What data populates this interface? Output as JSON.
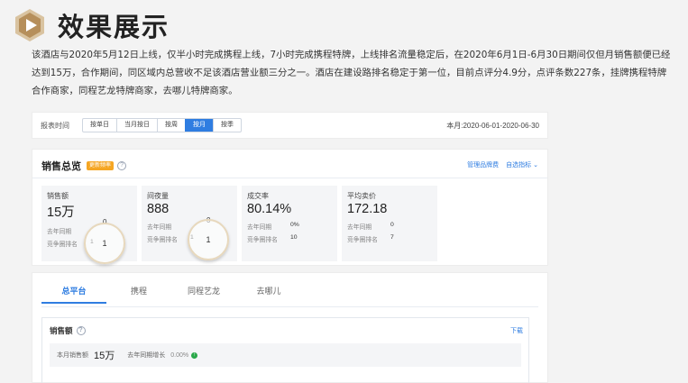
{
  "header": {
    "title": "效果展示",
    "logo_icon": "play-badge-icon"
  },
  "intro": {
    "text": "该酒店与2020年5月12日上线，仅半小时完成携程上线，7小时完成携程特牌，上线排名流量稳定后，在2020年6月1日-6月30日期间仅但月销售额便已经达到15万，合作期间，同区域内总营收不足该酒店营业额三分之一。酒店在建设路排名稳定于第一位，目前点评分4.9分，点评条数227条，挂牌携程特牌合作商家，同程艺龙特牌商家，去哪儿特牌商家。"
  },
  "filter": {
    "label": "报表时间",
    "buttons": [
      "按单日",
      "当月按日",
      "按周",
      "按月",
      "按季"
    ],
    "active_index": 3,
    "date_range": "本月:2020-06-01-2020-06-30"
  },
  "overview": {
    "title": "销售总览",
    "tag": "更新频率",
    "links": [
      "管理品牌费",
      "自选指标"
    ],
    "metrics": [
      {
        "name": "销售额",
        "value": "15万",
        "rows": [
          {
            "label": "去年同期",
            "value": ""
          },
          {
            "label": "竞争圈排名",
            "value": "1"
          }
        ],
        "loupe_top": "0",
        "loupe_value": "1"
      },
      {
        "name": "间夜量",
        "value": "888",
        "rows": [
          {
            "label": "去年同期",
            "value": ""
          },
          {
            "label": "竞争圈排名",
            "value": "1"
          }
        ],
        "loupe_top": "0",
        "loupe_value": "1"
      },
      {
        "name": "成交率",
        "value": "80.14%",
        "rows": [
          {
            "label": "去年同期",
            "value": "0%"
          },
          {
            "label": "竞争圈排名",
            "value": "10"
          }
        ]
      },
      {
        "name": "平均卖价",
        "value": "172.18",
        "rows": [
          {
            "label": "去年同期",
            "value": "0"
          },
          {
            "label": "竞争圈排名",
            "value": "7"
          }
        ]
      }
    ]
  },
  "platform": {
    "tabs": [
      "总平台",
      "携程",
      "同程艺龙",
      "去哪儿"
    ],
    "active_index": 0,
    "sales": {
      "title": "销售额",
      "download": "下载",
      "label": "本月销售额",
      "value": "15万",
      "compare_label": "去年同期增长",
      "compare_value": "0.00%"
    }
  },
  "colors": {
    "accent": "#2f7de1",
    "tag": "#f5a623",
    "up": "#2aa84a"
  }
}
